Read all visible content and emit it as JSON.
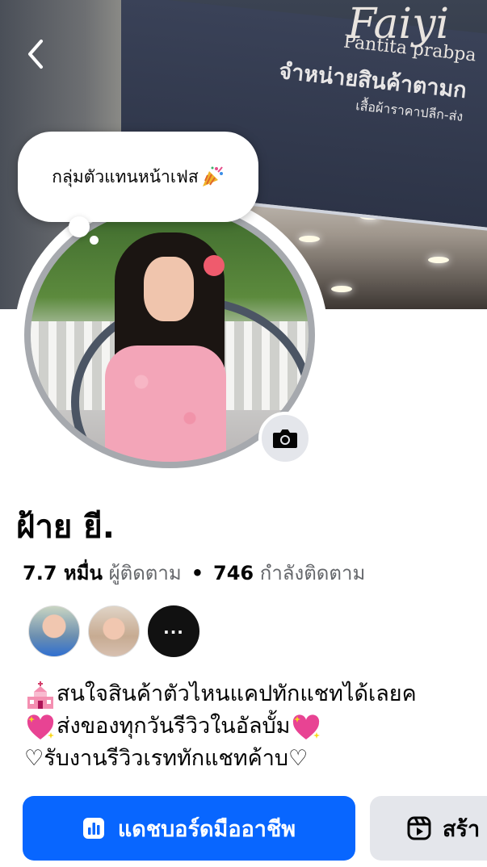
{
  "cover": {
    "sign_logo": "Faiyi",
    "sign_subtitle": "Pantita prabpa",
    "sign_main": "จำหน่ายสินค้าตามก",
    "sign_small": "เสื้อผ้าราคาปลีก-ส่ง"
  },
  "header": {
    "back_icon": "chevron-left-icon"
  },
  "note": {
    "text": "กลุ่มตัวแทนหน้าเฟส",
    "emoji": "party-popper"
  },
  "profile": {
    "name": "ฝ้าย ยี.",
    "followers_count": "7.7 หมื่น",
    "followers_label": "ผู้ติดตาม",
    "separator": "•",
    "following_count": "746",
    "following_label": "กำลังติดตาม",
    "more_friends": "..."
  },
  "bio": {
    "line1": "สนใจสินค้าตัวไหนแคปทักแชทได้เลยค",
    "line2": "ส่งของทุกวันรีวิวในอัลบั้ม",
    "line3": "♡รับงานรีวิวเรททักแชทค้าบ♡"
  },
  "buttons": {
    "dashboard_label": "แดชบอร์ดมืออาชีพ",
    "create_label": "สร้า"
  },
  "colors": {
    "primary": "#0866ff",
    "secondary_bg": "#e4e6eb",
    "text": "#050505",
    "muted": "#65676b"
  }
}
